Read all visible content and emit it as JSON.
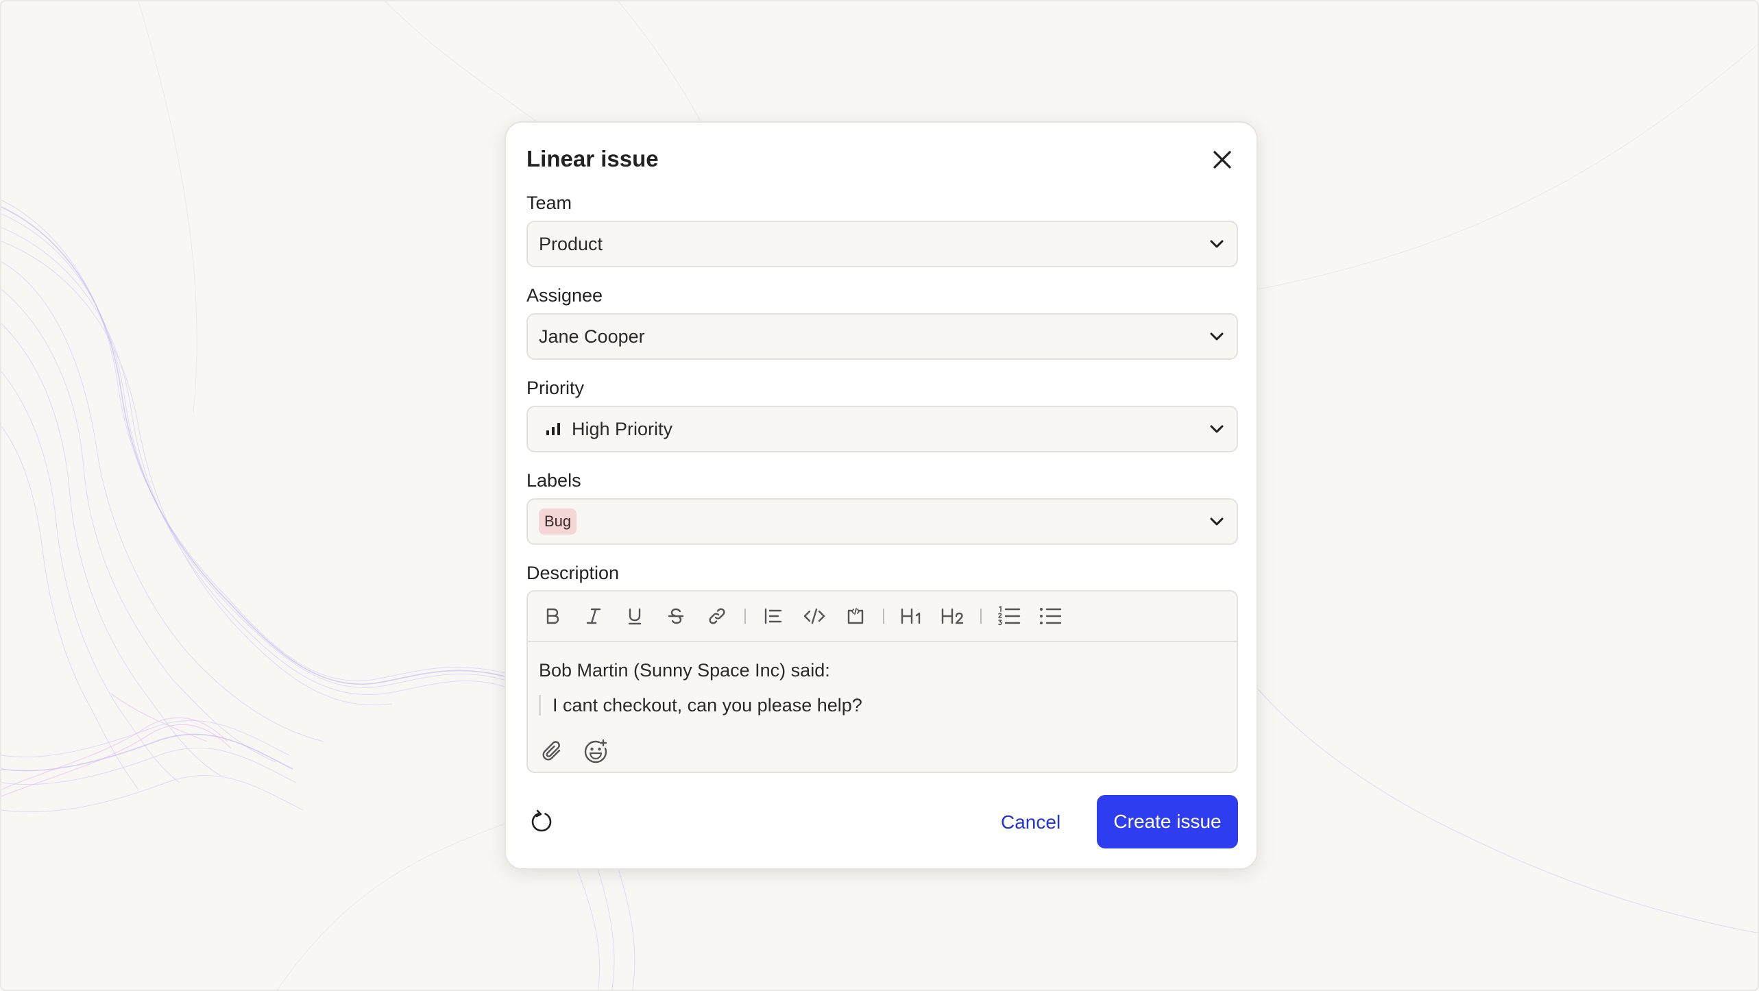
{
  "dialog": {
    "title": "Linear issue"
  },
  "fields": {
    "team": {
      "label": "Team",
      "value": "Product"
    },
    "assignee": {
      "label": "Assignee",
      "value": "Jane Cooper"
    },
    "priority": {
      "label": "Priority",
      "value": "High Priority",
      "icon": "signal-bars-icon"
    },
    "labels": {
      "label": "Labels",
      "tags": [
        "Bug"
      ],
      "tag_color": "#f6d5d6"
    },
    "description": {
      "label": "Description",
      "toolbar": [
        "bold",
        "italic",
        "underline",
        "strikethrough",
        "link",
        "quote",
        "code",
        "code-block",
        "heading-1",
        "heading-2",
        "ordered-list",
        "bullet-list"
      ],
      "text_line": "Bob Martin (Sunny Space Inc) said:",
      "quote_line": "I cant checkout, can you please help?"
    }
  },
  "footer": {
    "cancel_label": "Cancel",
    "create_label": "Create issue"
  },
  "colors": {
    "accent": "#2f3df0",
    "link": "#2433d6",
    "background": "#f8f7f4"
  }
}
